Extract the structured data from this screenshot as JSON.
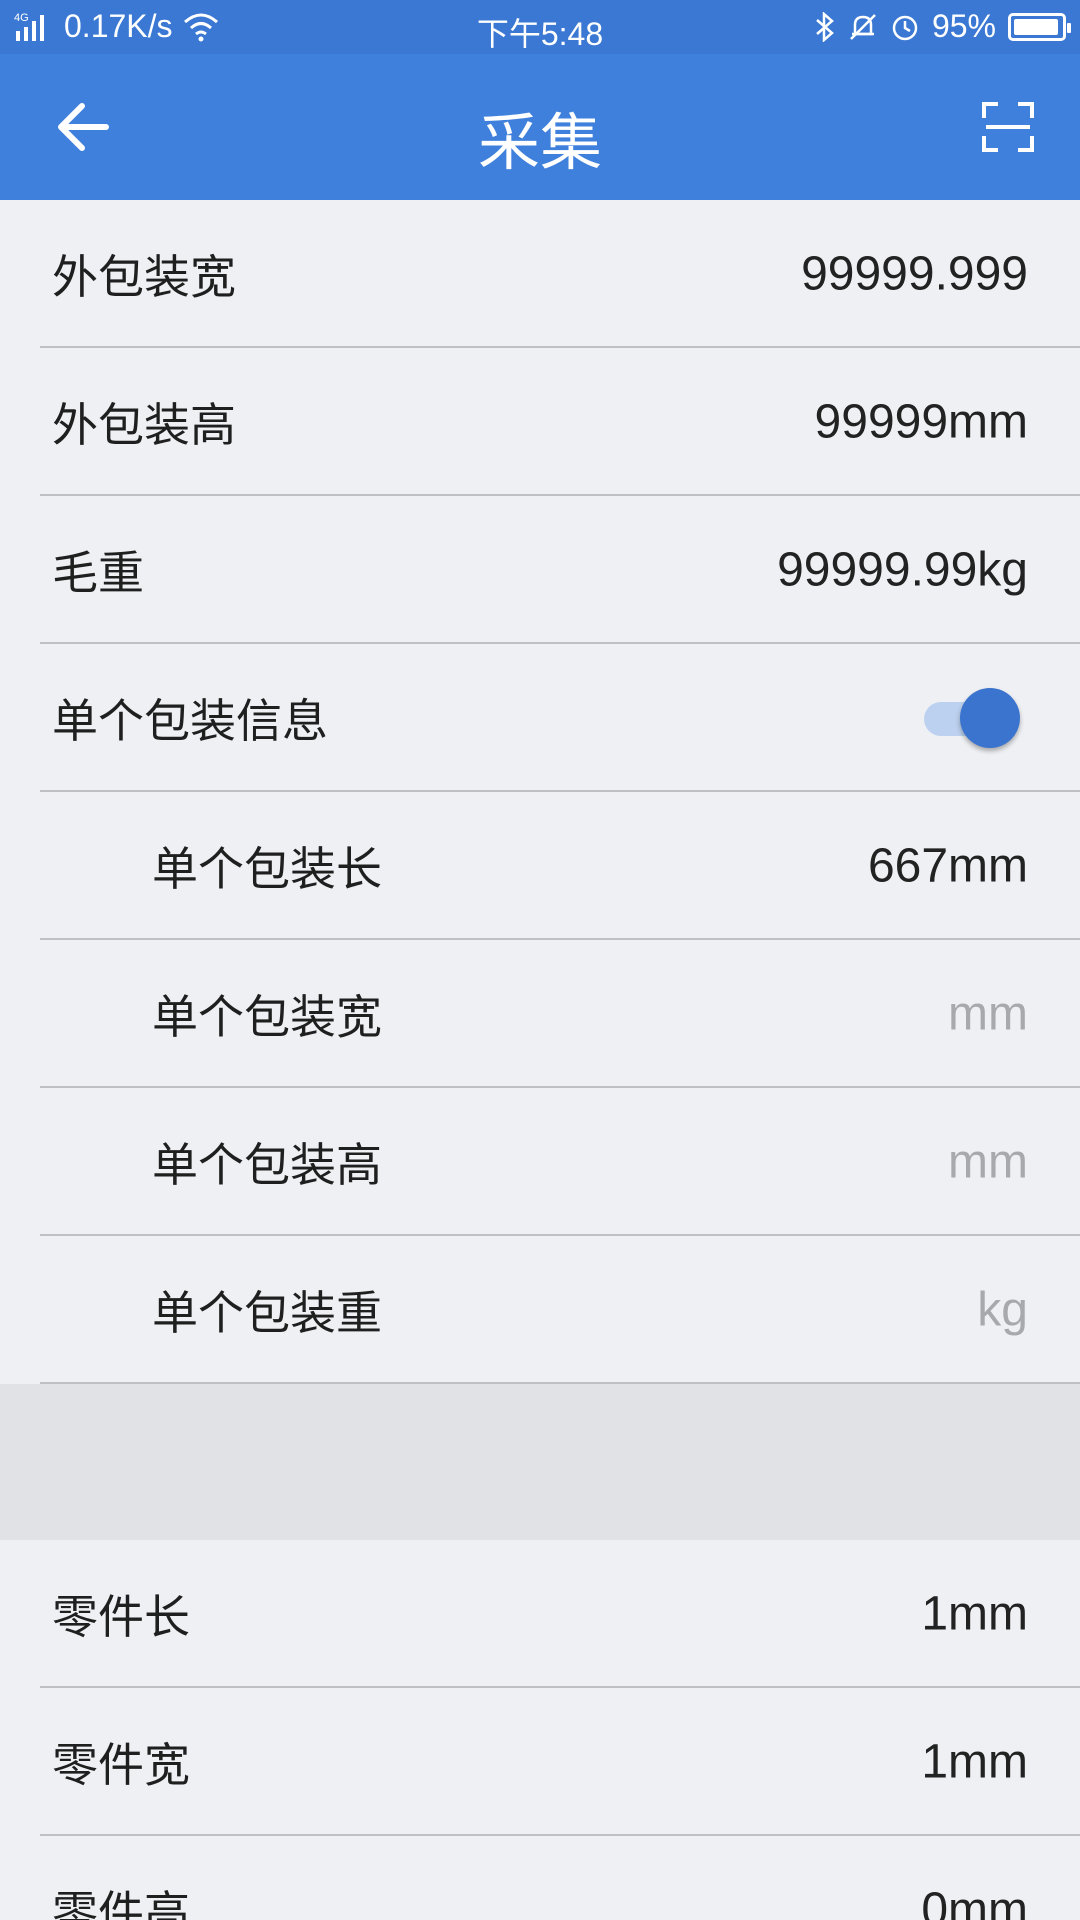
{
  "status_bar": {
    "network": "4G",
    "speed": "0.17K/s",
    "time": "下午5:48",
    "battery": "95%",
    "battery_level": 0.95,
    "icons": [
      "signal-icon",
      "wifi-icon",
      "bluetooth-icon",
      "mute-icon",
      "alarm-icon",
      "battery-icon"
    ]
  },
  "app_bar": {
    "title": "采集",
    "back_icon": "arrow-left-icon",
    "scan_icon": "scan-icon",
    "background": "#3f80dc"
  },
  "rows_top": [
    {
      "label": "外包装宽",
      "value": "99999.999"
    },
    {
      "label": "外包装高",
      "value": "99999mm"
    },
    {
      "label": "毛重",
      "value": "99999.99kg"
    }
  ],
  "toggle_row": {
    "label": "单个包装信息",
    "on": true
  },
  "rows_indented": [
    {
      "label": "单个包装长",
      "value": "667mm"
    },
    {
      "label": "单个包装宽",
      "placeholder": "mm"
    },
    {
      "label": "单个包装高",
      "placeholder": "mm"
    },
    {
      "label": "单个包装重",
      "placeholder": "kg"
    }
  ],
  "rows_bottom": [
    {
      "label": "零件长",
      "value": "1mm"
    },
    {
      "label": "零件宽",
      "value": "1mm"
    },
    {
      "label": "零件高",
      "value": "0mm"
    }
  ],
  "colors": {
    "accent": "#3f80dc",
    "toggle_knob": "#3a74cf",
    "toggle_track": "#bcd1ef",
    "placeholder": "#a8a9ad"
  }
}
